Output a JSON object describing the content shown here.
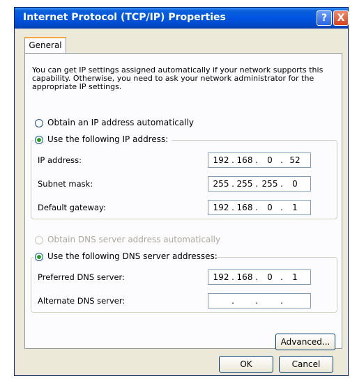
{
  "window": {
    "title": "Internet Protocol (TCP/IP) Properties",
    "help_glyph": "?",
    "close_glyph": "X"
  },
  "tabs": [
    {
      "label": "General",
      "active": true
    }
  ],
  "intro_text": "You can get IP settings assigned automatically if your network supports this capability. Otherwise, you need to ask your network administrator for the appropriate IP settings.",
  "ip_mode": {
    "auto_label": "Obtain an IP address automatically",
    "manual_label": "Use the following IP address:",
    "selected": "manual"
  },
  "ip_fields": [
    {
      "label": "IP address:",
      "octets": [
        "192",
        "168",
        "0",
        "52"
      ]
    },
    {
      "label": "Subnet mask:",
      "octets": [
        "255",
        "255",
        "255",
        "0"
      ]
    },
    {
      "label": "Default gateway:",
      "octets": [
        "192",
        "168",
        "0",
        "1"
      ]
    }
  ],
  "dns_mode": {
    "auto_label": "Obtain DNS server address automatically",
    "manual_label": "Use the following DNS server addresses:",
    "selected": "manual",
    "auto_disabled": true
  },
  "dns_fields": [
    {
      "label": "Preferred DNS server:",
      "octets": [
        "192",
        "168",
        "0",
        "1"
      ]
    },
    {
      "label": "Alternate DNS server:",
      "octets": [
        "",
        "",
        "",
        ""
      ]
    }
  ],
  "ip_dot": ".",
  "buttons": {
    "advanced": "Advanced...",
    "ok": "OK",
    "cancel": "Cancel"
  },
  "colors": {
    "title_bar": "#0054e3",
    "dialog_bg": "#ece9d8",
    "radio_selected": "#21a121",
    "tab_accent": "#f5a83c"
  }
}
